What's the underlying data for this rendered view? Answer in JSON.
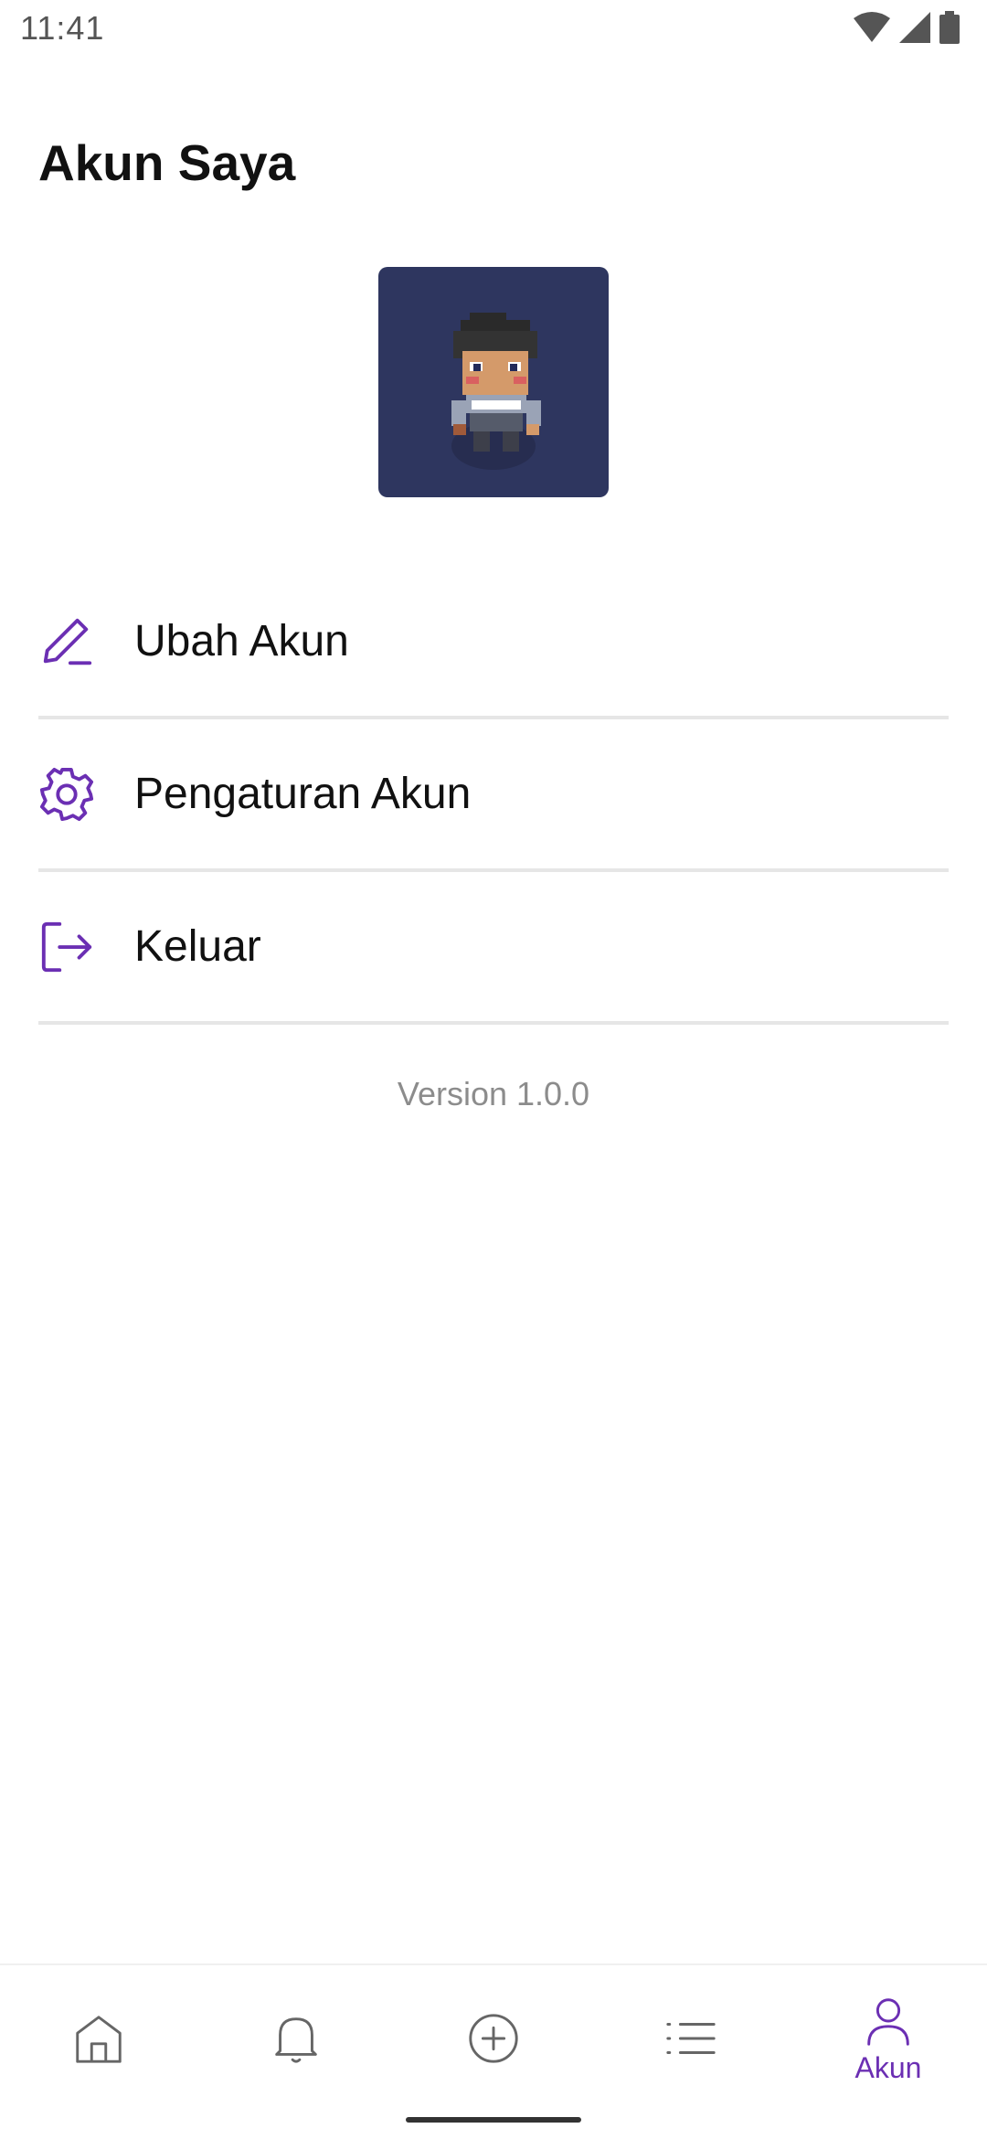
{
  "status_bar": {
    "time": "11:41"
  },
  "header": {
    "title": "Akun Saya"
  },
  "menu": {
    "items": [
      {
        "label": "Ubah Akun",
        "icon": "pencil-icon"
      },
      {
        "label": "Pengaturan Akun",
        "icon": "gear-icon"
      },
      {
        "label": "Keluar",
        "icon": "logout-icon"
      }
    ]
  },
  "version": "Version 1.0.0",
  "bottom_nav": {
    "items": [
      {
        "icon": "home-icon",
        "label": ""
      },
      {
        "icon": "bell-icon",
        "label": ""
      },
      {
        "icon": "plus-circle-icon",
        "label": ""
      },
      {
        "icon": "list-icon",
        "label": ""
      },
      {
        "icon": "user-icon",
        "label": "Akun",
        "active": true
      }
    ]
  },
  "colors": {
    "accent": "#6b2fb3",
    "avatar_bg": "#2e365f",
    "divider": "#e6e6e6"
  }
}
